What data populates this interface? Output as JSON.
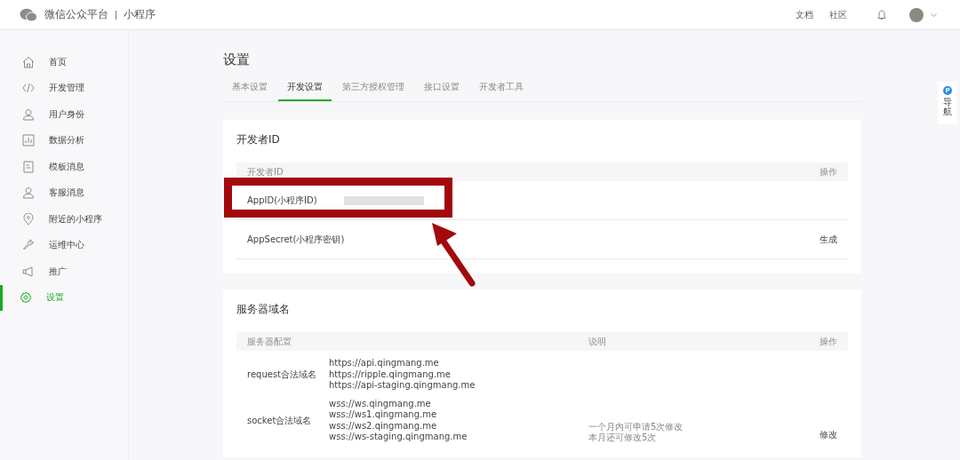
{
  "header": {
    "brand": "微信公众平台",
    "product": "小程序",
    "links": [
      "文档",
      "社区"
    ]
  },
  "sidebar": {
    "items": [
      {
        "label": "首页",
        "selected": false
      },
      {
        "label": "开发管理",
        "selected": false
      },
      {
        "label": "用户身份",
        "selected": false
      },
      {
        "label": "数据分析",
        "selected": false
      },
      {
        "label": "模板消息",
        "selected": false
      },
      {
        "label": "客服消息",
        "selected": false
      },
      {
        "label": "附近的小程序",
        "selected": false
      },
      {
        "label": "运维中心",
        "selected": false
      },
      {
        "label": "推广",
        "selected": false
      },
      {
        "label": "设置",
        "selected": true
      }
    ]
  },
  "page_title": "设置",
  "tabs": [
    {
      "label": "基本设置",
      "selected": false
    },
    {
      "label": "开发设置",
      "selected": true
    },
    {
      "label": "第三方授权管理",
      "selected": false
    },
    {
      "label": "接口设置",
      "selected": false
    },
    {
      "label": "开发者工具",
      "selected": false
    }
  ],
  "developer_card": {
    "title": "开发者ID",
    "columns": [
      "开发者ID",
      "操作"
    ],
    "rows": [
      {
        "name": "AppID(小程序ID)",
        "redacted": true
      },
      {
        "name": "AppSecret(小程序密钥)",
        "redacted": false,
        "action": "生成"
      }
    ]
  },
  "server_card": {
    "title": "服务器域名",
    "columns": [
      "服务器配置",
      "说明",
      "操作"
    ],
    "rows": [
      {
        "name": "request合法域名",
        "urls": [
          "https://api.qingmang.me",
          "https://ripple.qingmang.me",
          "https://api-staging.qingmang.me"
        ]
      },
      {
        "name": "socket合法域名",
        "urls": [
          "wss://ws.qingmang.me",
          "wss://ws1.qingmang.me",
          "wss://ws2.qingmang.me",
          "wss://ws-staging.qingmang.me"
        ],
        "note": [
          "一个月内可申请5次修改",
          "本月还可修改5次"
        ],
        "action": "修改"
      }
    ]
  },
  "float_nav": {
    "badge": "P",
    "label": "导航"
  }
}
